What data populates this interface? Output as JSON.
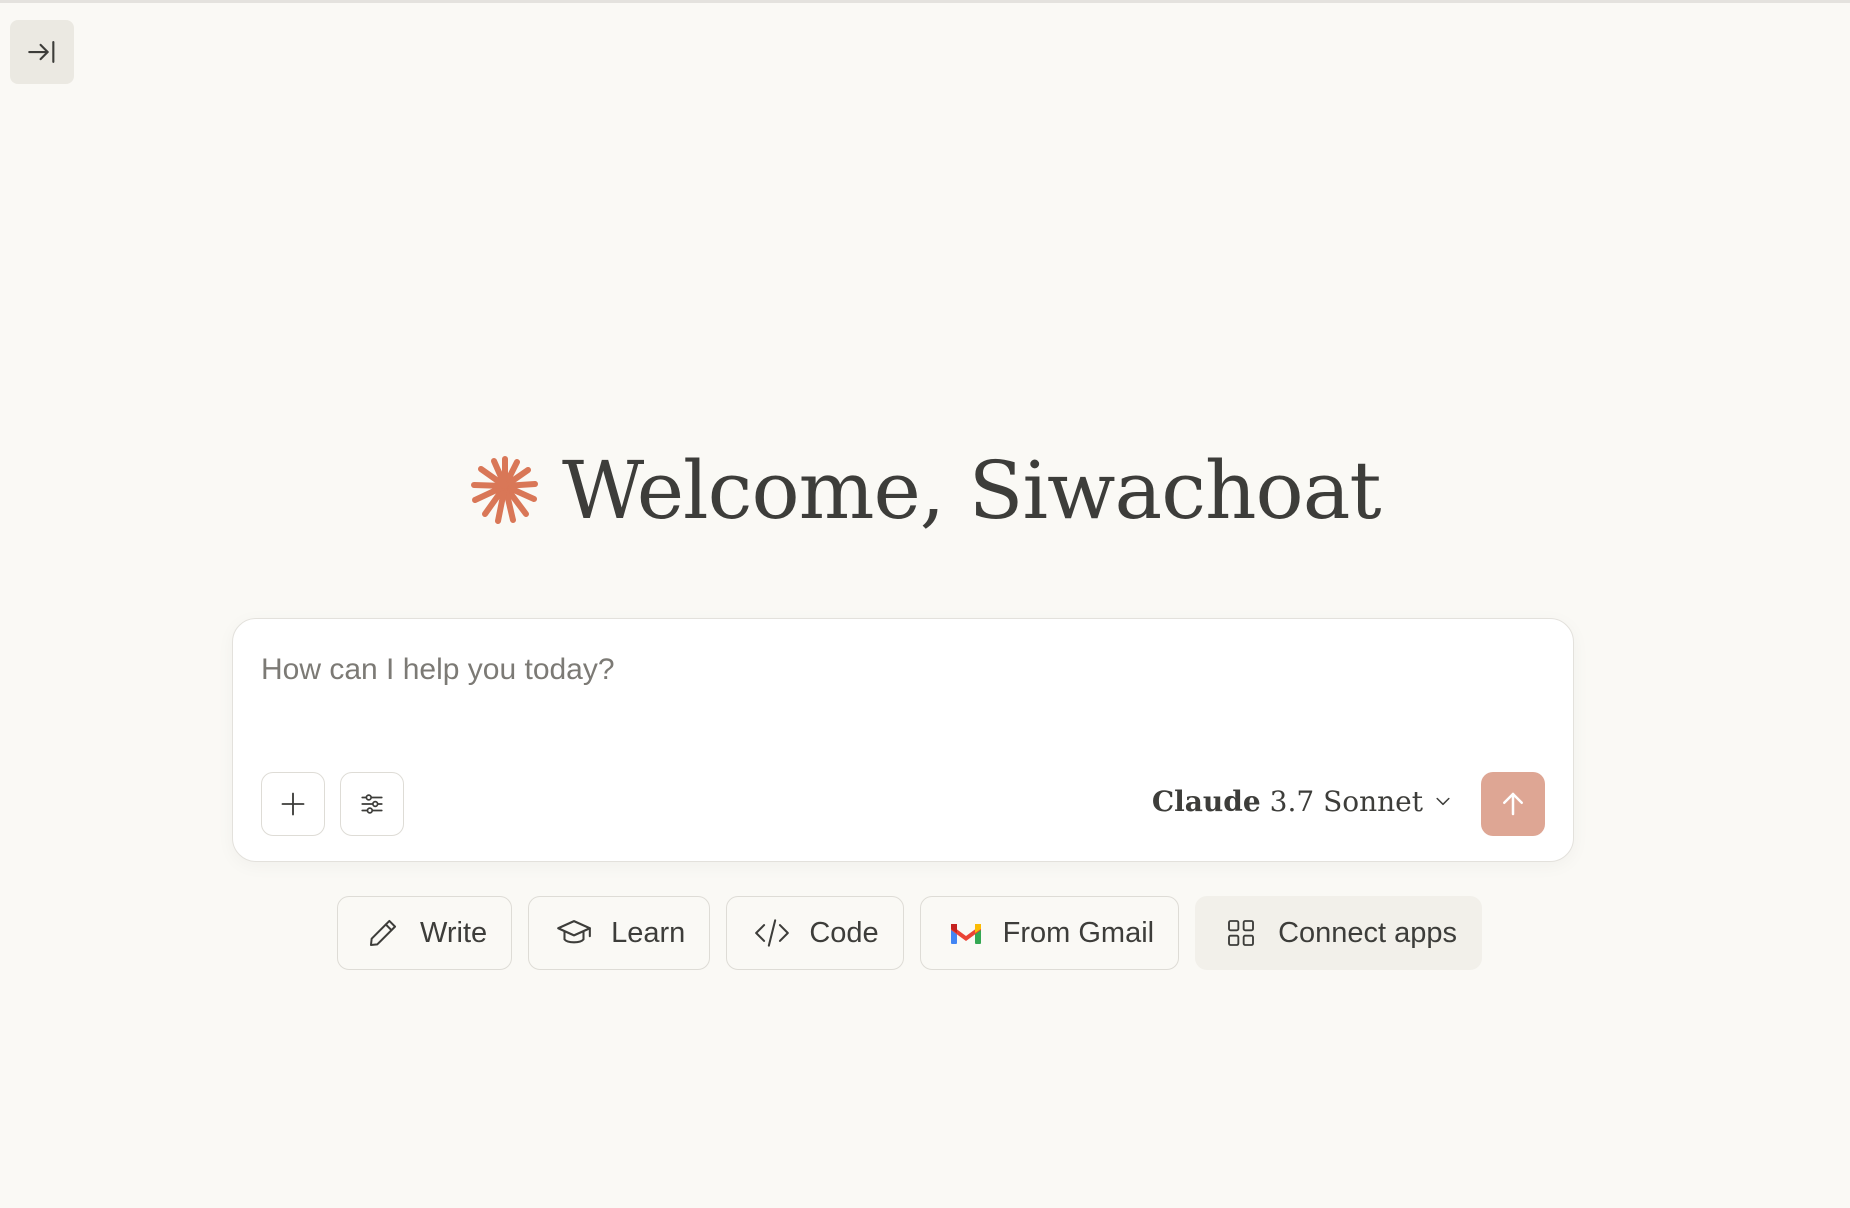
{
  "sidebar": {
    "toggle_icon": "expand-sidebar-icon"
  },
  "welcome": {
    "logo_icon": "claude-spark-icon",
    "logo_color": "#d97757",
    "title": "Welcome, Siwachoat"
  },
  "composer": {
    "placeholder": "How can I help you today?",
    "value": "",
    "attach_icon": "plus-icon",
    "tools_icon": "sliders-icon",
    "model": {
      "name": "Claude",
      "version": "3.7 Sonnet",
      "dropdown_icon": "chevron-down-icon"
    },
    "send_icon": "arrow-up-icon",
    "send_color": "#dea694"
  },
  "suggestions": [
    {
      "label": "Write",
      "icon": "pencil-icon"
    },
    {
      "label": "Learn",
      "icon": "graduation-cap-icon"
    },
    {
      "label": "Code",
      "icon": "code-icon"
    },
    {
      "label": "From Gmail",
      "icon": "gmail-icon"
    },
    {
      "label": "Connect apps",
      "icon": "grid-icon"
    }
  ]
}
